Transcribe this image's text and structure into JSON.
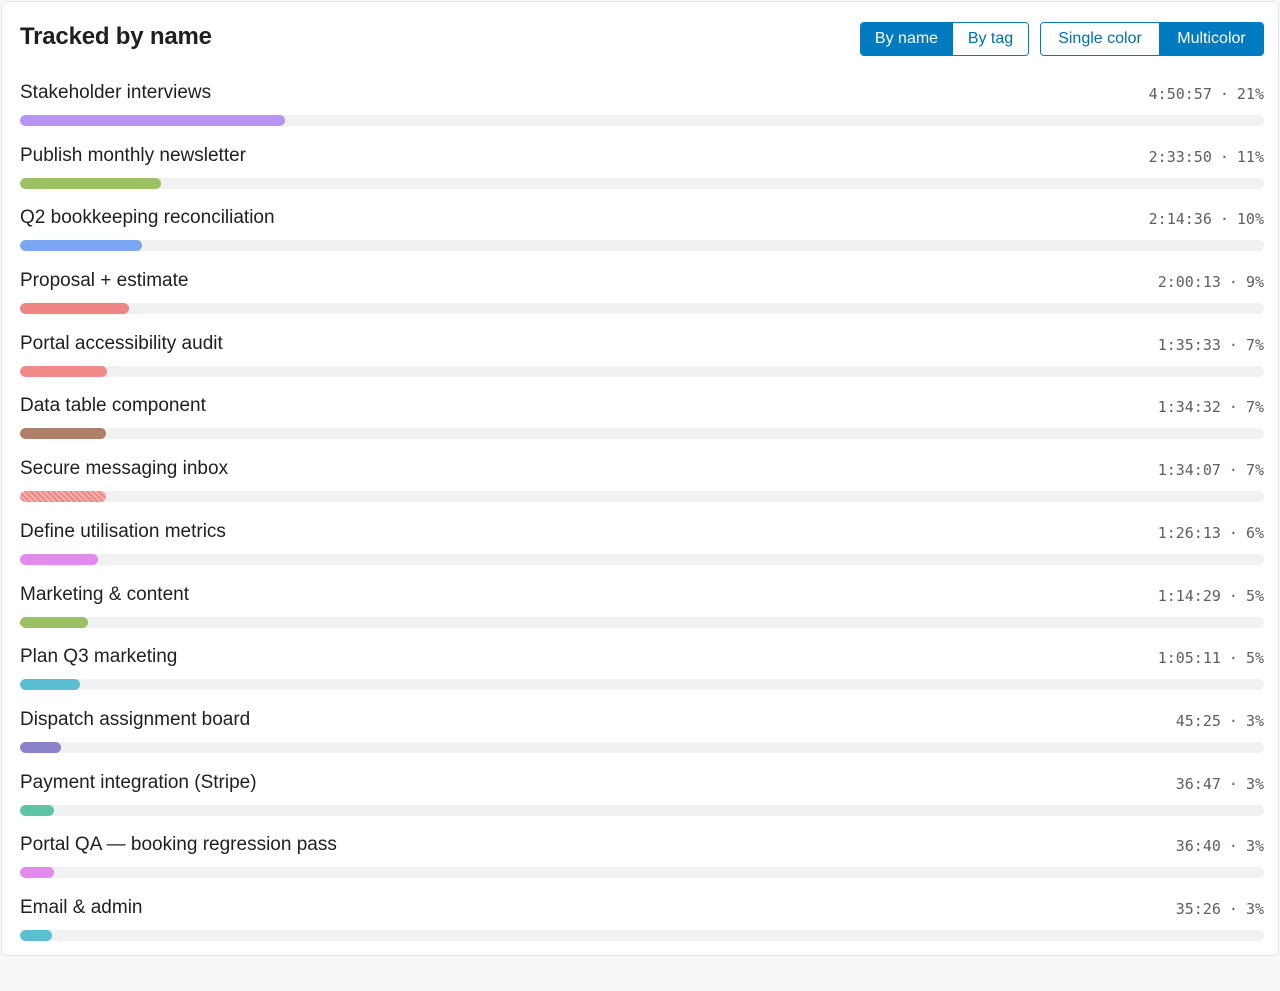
{
  "panel": {
    "title": "Tracked by name",
    "mode_toggle": [
      {
        "label": "By name",
        "active": true
      },
      {
        "label": "By tag",
        "active": false
      }
    ],
    "color_toggle": [
      {
        "label": "Single color",
        "active": false
      },
      {
        "label": "Multicolor",
        "active": true
      }
    ]
  },
  "rows": [
    {
      "name": "Stakeholder interviews",
      "time": "4:50:57",
      "percent": "21%",
      "share": 0.213,
      "color": "#b794f4"
    },
    {
      "name": "Publish monthly newsletter",
      "time": "2:33:50",
      "percent": "11%",
      "share": 0.113,
      "color": "#9bc065"
    },
    {
      "name": "Q2 bookkeeping reconciliation",
      "time": "2:14:36",
      "percent": "10%",
      "share": 0.098,
      "color": "#7aa6f2"
    },
    {
      "name": "Proposal + estimate",
      "time": "2:00:13",
      "percent": "9%",
      "share": 0.088,
      "color": "#ef8585"
    },
    {
      "name": "Portal accessibility audit",
      "time": "1:35:33",
      "percent": "7%",
      "share": 0.07,
      "color": "#f28a8a"
    },
    {
      "name": "Data table component",
      "time": "1:34:32",
      "percent": "7%",
      "share": 0.069,
      "color": "#b07f68"
    },
    {
      "name": "Secure messaging inbox",
      "time": "1:34:07",
      "percent": "7%",
      "share": 0.069,
      "color": "#f08585",
      "striped": true
    },
    {
      "name": "Define utilisation metrics",
      "time": "1:26:13",
      "percent": "6%",
      "share": 0.063,
      "color": "#e28aee"
    },
    {
      "name": "Marketing & content",
      "time": "1:14:29",
      "percent": "5%",
      "share": 0.055,
      "color": "#9bc065"
    },
    {
      "name": "Plan Q3 marketing",
      "time": "1:05:11",
      "percent": "5%",
      "share": 0.048,
      "color": "#5bbfd3"
    },
    {
      "name": "Dispatch assignment board",
      "time": "45:25",
      "percent": "3%",
      "share": 0.033,
      "color": "#8a82c8"
    },
    {
      "name": "Payment integration (Stripe)",
      "time": "36:47",
      "percent": "3%",
      "share": 0.027,
      "color": "#5cc5a8"
    },
    {
      "name": "Portal QA — booking regression pass",
      "time": "36:40",
      "percent": "3%",
      "share": 0.027,
      "color": "#e28aee"
    },
    {
      "name": "Email & admin",
      "time": "35:26",
      "percent": "3%",
      "share": 0.026,
      "color": "#5bbfd3"
    }
  ]
}
